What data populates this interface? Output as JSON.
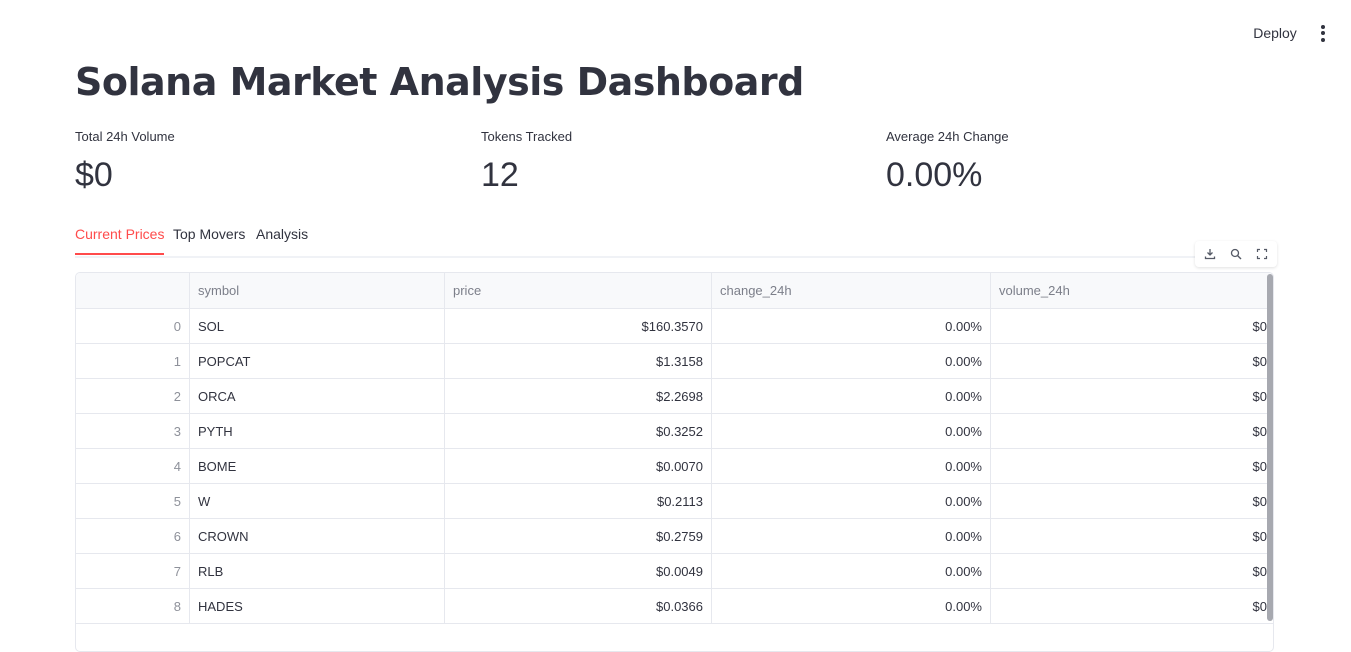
{
  "toolbar": {
    "deploy_label": "Deploy"
  },
  "page": {
    "title": "Solana Market Analysis Dashboard"
  },
  "metrics": [
    {
      "label": "Total 24h Volume",
      "value": "$0"
    },
    {
      "label": "Tokens Tracked",
      "value": "12"
    },
    {
      "label": "Average 24h Change",
      "value": "0.00%"
    }
  ],
  "tabs": [
    {
      "label": "Current Prices",
      "active": true
    },
    {
      "label": "Top Movers",
      "active": false
    },
    {
      "label": "Analysis",
      "active": false
    }
  ],
  "table": {
    "columns": [
      "",
      "symbol",
      "price",
      "change_24h",
      "volume_24h"
    ],
    "rows": [
      [
        "0",
        "SOL",
        "$160.3570",
        "0.00%",
        "$0"
      ],
      [
        "1",
        "POPCAT",
        "$1.3158",
        "0.00%",
        "$0"
      ],
      [
        "2",
        "ORCA",
        "$2.2698",
        "0.00%",
        "$0"
      ],
      [
        "3",
        "PYTH",
        "$0.3252",
        "0.00%",
        "$0"
      ],
      [
        "4",
        "BOME",
        "$0.0070",
        "0.00%",
        "$0"
      ],
      [
        "5",
        "W",
        "$0.2113",
        "0.00%",
        "$0"
      ],
      [
        "6",
        "CROWN",
        "$0.2759",
        "0.00%",
        "$0"
      ],
      [
        "7",
        "RLB",
        "$0.0049",
        "0.00%",
        "$0"
      ],
      [
        "8",
        "HADES",
        "$0.0366",
        "0.00%",
        "$0"
      ]
    ]
  },
  "icons": {
    "download": "download-icon",
    "search": "search-icon",
    "fullscreen": "fullscreen-icon",
    "menu": "kebab-menu-icon"
  },
  "colors": {
    "accent": "#ff4b4b",
    "text": "#31333f"
  }
}
